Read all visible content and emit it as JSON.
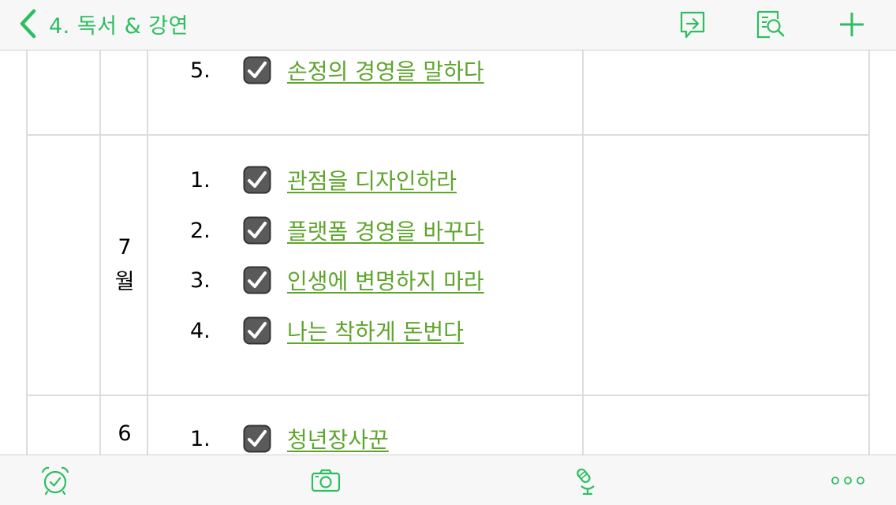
{
  "header": {
    "back_title": "4. 독서 & 강연",
    "icons": [
      "back-chevron-icon",
      "share-icon",
      "find-in-note-icon",
      "plus-icon"
    ]
  },
  "colors": {
    "accent": "#2dbe60",
    "link": "#5ea52b",
    "grid": "#dcdcdc"
  },
  "table": {
    "rows": [
      {
        "month_num": "",
        "month_unit": "",
        "items": [
          {
            "num": "5.",
            "title": "손정의 경영을 말하다",
            "checked": true
          }
        ]
      },
      {
        "month_num": "7",
        "month_unit": "월",
        "items": [
          {
            "num": "1.",
            "title": "관점을 디자인하라",
            "checked": true
          },
          {
            "num": "2.",
            "title": "플랫폼 경영을 바꾸다",
            "checked": true
          },
          {
            "num": "3.",
            "title": "인생에 변명하지 마라",
            "checked": true
          },
          {
            "num": "4.",
            "title": "나는 착하게 돈번다",
            "checked": true
          }
        ]
      },
      {
        "month_num": "6",
        "month_unit": "",
        "items": [
          {
            "num": "1.",
            "title": "청년장사꾼",
            "checked": true
          }
        ]
      }
    ]
  },
  "footer": {
    "icons": [
      "reminder-alarm-icon",
      "camera-icon",
      "microphone-icon",
      "more-icon"
    ]
  }
}
